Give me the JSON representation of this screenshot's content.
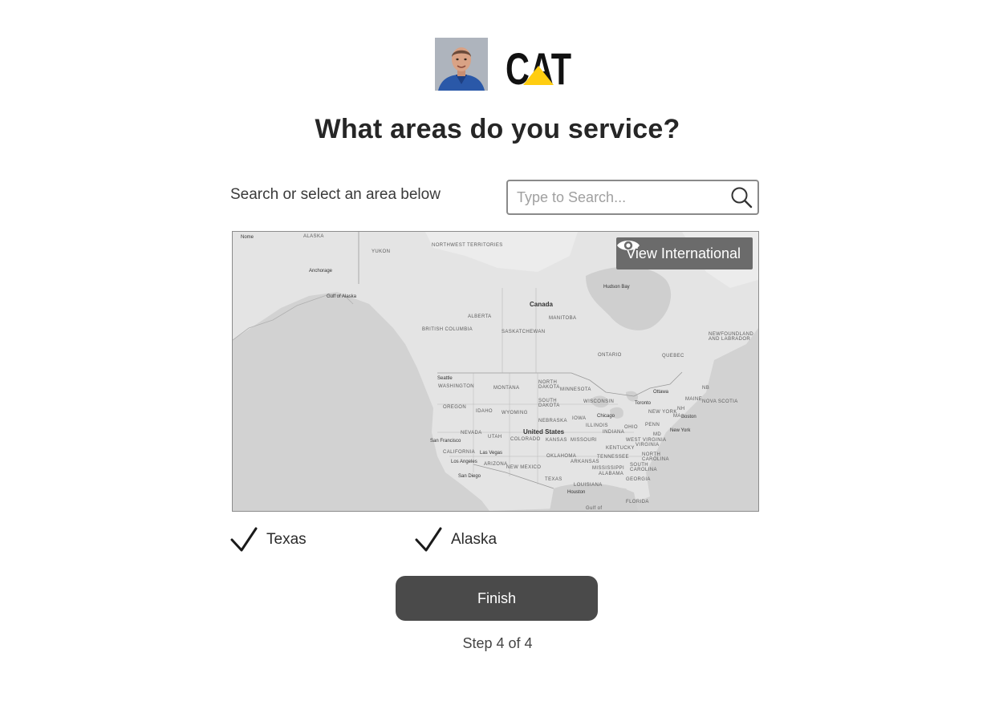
{
  "header": {
    "avatar_icon": "person-photo",
    "logo_text": "CAT",
    "logo_colors": {
      "text": "#111111",
      "triangle": "#ffcd11"
    }
  },
  "title": "What areas do you service?",
  "search": {
    "instruction": "Search or select an area below",
    "placeholder": "Type to Search...",
    "value": "",
    "icon": "search-icon"
  },
  "map": {
    "view_international_label": "View International",
    "view_icon": "eye-icon",
    "labels": {
      "alaska": "ALASKA",
      "nome": "Nome",
      "anchorage": "Anchorage",
      "gulf_of_alaska": "Gulf of Alaska",
      "yukon": "YUKON",
      "nwt": "NORTHWEST TERRITORIES",
      "bc": "BRITISH COLUMBIA",
      "alberta": "ALBERTA",
      "saskatchewan": "SASKATCHEWAN",
      "manitoba": "MANITOBA",
      "canada": "Canada",
      "hudson_bay": "Hudson Bay",
      "ontario": "ONTARIO",
      "quebec": "QUEBEC",
      "newfoundland": "NEWFOUNDLAND AND LABRADOR",
      "washington": "WASHINGTON",
      "seattle": "Seattle",
      "oregon": "OREGON",
      "idaho": "IDAHO",
      "montana": "MONTANA",
      "wyoming": "WYOMING",
      "nevada": "NEVADA",
      "utah": "UTAH",
      "colorado": "COLORADO",
      "california": "CALIFORNIA",
      "san_francisco": "San Francisco",
      "las_vegas": "Las Vegas",
      "los_angeles": "Los Angeles",
      "san_diego": "San Diego",
      "arizona": "ARIZONA",
      "new_mexico": "NEW MEXICO",
      "north_dakota": "NORTH DAKOTA",
      "south_dakota": "SOUTH DAKOTA",
      "nebraska": "NEBRASKA",
      "kansas": "KANSAS",
      "oklahoma": "OKLAHOMA",
      "texas": "TEXAS",
      "united_states": "United States",
      "minnesota": "MINNESOTA",
      "iowa": "IOWA",
      "missouri": "MISSOURI",
      "arkansas": "ARKANSAS",
      "louisiana": "LOUISIANA",
      "wisconsin": "WISCONSIN",
      "illinois": "ILLINOIS",
      "chicago": "Chicago",
      "indiana": "INDIANA",
      "ohio": "OHIO",
      "kentucky": "KENTUCKY",
      "tennessee": "TENNESSEE",
      "mississippi": "MISSISSIPPI",
      "alabama": "ALABAMA",
      "georgia": "GEORGIA",
      "florida": "FLORIDA",
      "south_carolina": "SOUTH CAROLINA",
      "north_carolina": "NORTH CAROLINA",
      "virginia": "VIRGINIA",
      "west_virginia": "WEST VIRGINIA",
      "penn": "PENN",
      "new_york_state": "NEW YORK",
      "new_york": "New York",
      "toronto": "Toronto",
      "ottawa": "Ottawa",
      "boston": "Boston",
      "maine": "MAINE",
      "nova_scotia": "NOVA SCOTIA",
      "nb": "NB",
      "nh": "NH",
      "ma": "MA",
      "md": "MD",
      "houston": "Houston",
      "gulf_of_mexico": "Gulf of"
    }
  },
  "selected_areas": [
    {
      "label": "Texas",
      "icon": "check-icon"
    },
    {
      "label": "Alaska",
      "icon": "check-icon"
    }
  ],
  "finish_label": "Finish",
  "step_text": "Step 4 of 4"
}
